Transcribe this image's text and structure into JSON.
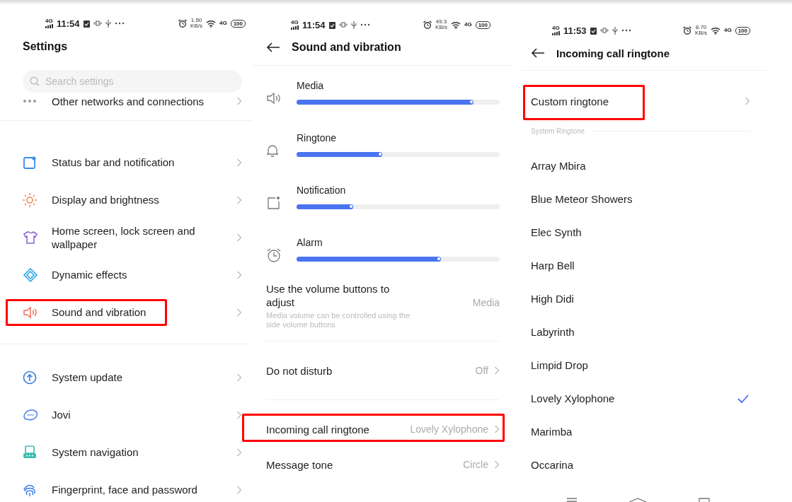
{
  "panels": [
    {
      "kind": "settings",
      "status": {
        "network": "4G",
        "time": "11:54",
        "speed": "1.50",
        "speed_unit": "KB/s",
        "data": "4G",
        "battery": "100"
      },
      "title": "Settings",
      "search": {
        "placeholder": "Search settings"
      },
      "groups": [
        [
          {
            "label": "Other networks and connections",
            "highlighted": false
          }
        ],
        [
          {
            "label": "Status bar and notification",
            "highlighted": false
          },
          {
            "label": "Display and brightness",
            "highlighted": false
          },
          {
            "label": "Home screen, lock screen and wallpaper",
            "highlighted": false
          },
          {
            "label": "Dynamic effects",
            "highlighted": false
          },
          {
            "label": "Sound and vibration",
            "highlighted": true
          }
        ],
        [
          {
            "label": "System update",
            "highlighted": false
          },
          {
            "label": "Jovi",
            "highlighted": false
          },
          {
            "label": "System navigation",
            "highlighted": false
          },
          {
            "label": "Fingerprint, face and password",
            "highlighted": false
          }
        ]
      ]
    },
    {
      "kind": "sound",
      "status": {
        "network": "4G",
        "time": "11:54",
        "speed": "49.3",
        "speed_unit": "KB/s",
        "data": "4G",
        "battery": "100"
      },
      "title": "Sound and vibration",
      "volumes": [
        {
          "label": "Media",
          "level": 0.87
        },
        {
          "label": "Ringtone",
          "level": 0.42
        },
        {
          "label": "Notification",
          "level": 0.28
        },
        {
          "label": "Alarm",
          "level": 0.71
        }
      ],
      "options": [
        {
          "label": "Use the volume buttons to adjust",
          "description": "Media volume can be controlled using the side volume buttons",
          "value": "Media",
          "chevron": false,
          "highlighted": false
        },
        {
          "label": "Do not disturb",
          "value": "Off",
          "chevron": true,
          "highlighted": false
        },
        {
          "label": "Incoming call ringtone",
          "value": "Lovely Xylophone",
          "chevron": true,
          "highlighted": true
        },
        {
          "label": "Message tone",
          "value": "Circle",
          "chevron": true,
          "highlighted": false
        }
      ]
    },
    {
      "kind": "ringtone",
      "status": {
        "network": "4G",
        "time": "11:53",
        "speed": "8.70",
        "speed_unit": "KB/s",
        "data": "4G",
        "battery": "100"
      },
      "title": "Incoming call ringtone",
      "custom": {
        "label": "Custom ringtone",
        "highlighted": true
      },
      "section": "System Ringtone",
      "ringtones": [
        {
          "label": "Array Mbira",
          "selected": false
        },
        {
          "label": "Blue Meteor Showers",
          "selected": false
        },
        {
          "label": "Elec Synth",
          "selected": false
        },
        {
          "label": "Harp Bell",
          "selected": false
        },
        {
          "label": "High Didi",
          "selected": false
        },
        {
          "label": "Labyrinth",
          "selected": false
        },
        {
          "label": "Limpid Drop",
          "selected": false
        },
        {
          "label": "Lovely Xylophone",
          "selected": true
        },
        {
          "label": "Marimba",
          "selected": false
        },
        {
          "label": "Occarina",
          "selected": false
        }
      ]
    }
  ]
}
